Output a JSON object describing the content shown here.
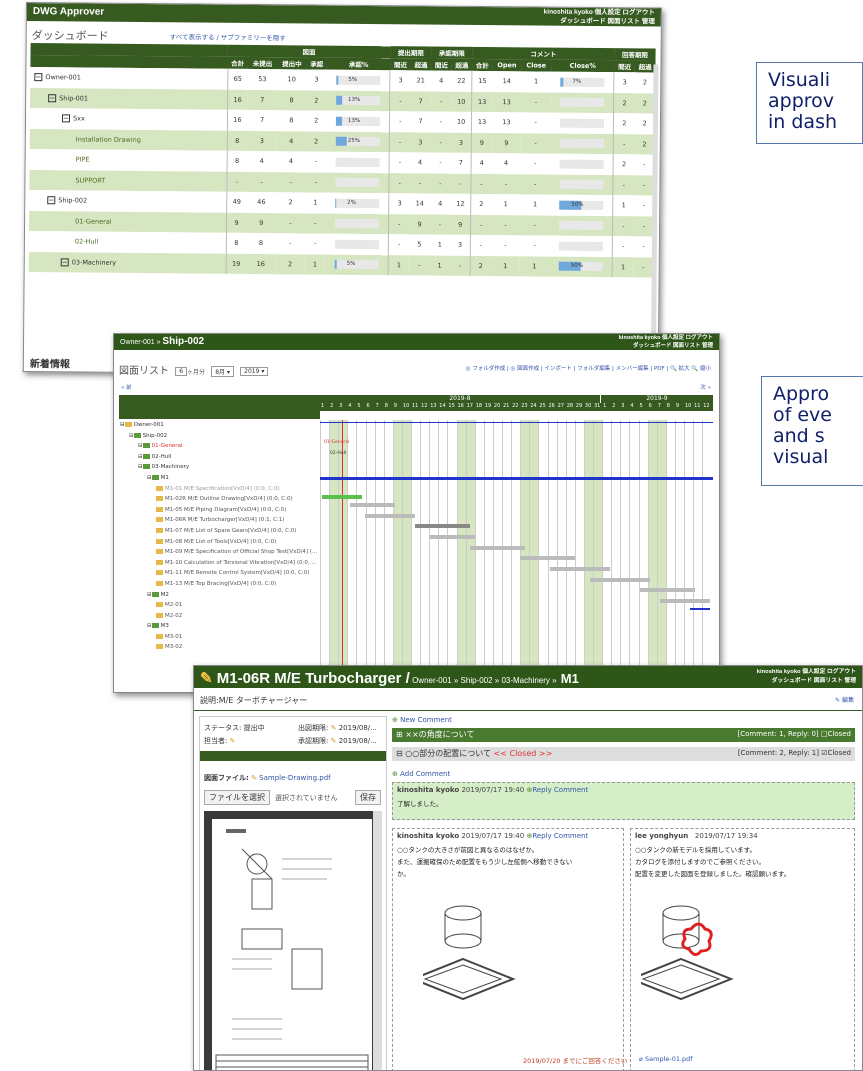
{
  "callouts": {
    "c1": [
      "Visuali",
      "approv",
      "in dash"
    ],
    "c2": [
      "Appro",
      "of eve",
      "and s",
      "visual"
    ]
  },
  "w1": {
    "app_title": "DWG Approver",
    "user_line1": "kinoshita kyoko 個人設定 ログアウト",
    "user_line2": "ダッシュボード 図面リスト 管理",
    "page_title": "ダッシュボード",
    "toggle_link": "すべて表示する / サブファミリーを隠す",
    "group_headers": [
      "図面",
      "提出期限",
      "承認期限",
      "コメント",
      "回答期限"
    ],
    "col_headers": [
      "合計",
      "未提出",
      "提出中",
      "承認",
      "承認%",
      "間近",
      "超過",
      "間近",
      "超過",
      "合計",
      "Open",
      "Close",
      "Close%",
      "間近",
      "超過"
    ],
    "rows": [
      {
        "name": "Owner-001",
        "exp": "−",
        "indent": 0,
        "bg": "w",
        "v": [
          "65",
          "53",
          "10",
          "3",
          "5%",
          "3",
          "21",
          "4",
          "22",
          "15",
          "14",
          "1",
          "7%",
          "3",
          "2"
        ],
        "p1": 5,
        "p2": 7
      },
      {
        "name": "Ship-001",
        "exp": "−",
        "indent": 1,
        "bg": "g",
        "v": [
          "16",
          "7",
          "8",
          "2",
          "13%",
          "-",
          "7",
          "-",
          "10",
          "13",
          "13",
          "-",
          "",
          "2",
          "2"
        ],
        "p1": 13,
        "p2": 0
      },
      {
        "name": "Sxx",
        "exp": "−",
        "indent": 2,
        "bg": "w",
        "v": [
          "16",
          "7",
          "8",
          "2",
          "13%",
          "-",
          "7",
          "-",
          "10",
          "13",
          "13",
          "-",
          "",
          "2",
          "2"
        ],
        "p1": 13,
        "p2": 0
      },
      {
        "name": "Installation Drawing",
        "exp": "",
        "indent": 3,
        "bg": "g",
        "v": [
          "8",
          "3",
          "4",
          "2",
          "25%",
          "-",
          "3",
          "-",
          "3",
          "9",
          "9",
          "-",
          "",
          "-",
          "2"
        ],
        "p1": 25,
        "p2": 0
      },
      {
        "name": "PIPE",
        "exp": "",
        "indent": 3,
        "bg": "w",
        "v": [
          "8",
          "4",
          "4",
          "-",
          "",
          "-",
          "4",
          "-",
          "7",
          "4",
          "4",
          "-",
          "",
          "2",
          "-"
        ],
        "p1": 0,
        "p2": 0
      },
      {
        "name": "SUPPORT",
        "exp": "",
        "indent": 3,
        "bg": "g",
        "v": [
          "-",
          "-",
          "-",
          "-",
          "",
          "-",
          "-",
          "-",
          "-",
          "-",
          "-",
          "-",
          "",
          "-",
          "-"
        ],
        "p1": 0,
        "p2": 0
      },
      {
        "name": "Ship-002",
        "exp": "−",
        "indent": 1,
        "bg": "w",
        "v": [
          "49",
          "46",
          "2",
          "1",
          "2%",
          "3",
          "14",
          "4",
          "12",
          "2",
          "1",
          "1",
          "50%",
          "1",
          "-"
        ],
        "p1": 2,
        "p2": 50
      },
      {
        "name": "01-General",
        "exp": "",
        "indent": 3,
        "bg": "g",
        "v": [
          "9",
          "9",
          "-",
          "-",
          "",
          "-",
          "9",
          "-",
          "9",
          "-",
          "-",
          "-",
          "",
          "-",
          "-"
        ],
        "p1": 0,
        "p2": 0
      },
      {
        "name": "02-Hull",
        "exp": "",
        "indent": 3,
        "bg": "w",
        "v": [
          "8",
          "8",
          "-",
          "-",
          "",
          "-",
          "5",
          "1",
          "3",
          "-",
          "-",
          "-",
          "",
          "-",
          "-"
        ],
        "p1": 0,
        "p2": 0
      },
      {
        "name": "03-Machinery",
        "exp": "−",
        "indent": 2,
        "bg": "g",
        "v": [
          "19",
          "16",
          "2",
          "1",
          "5%",
          "1",
          "-",
          "1",
          "-",
          "2",
          "1",
          "1",
          "50%",
          "1",
          "-"
        ],
        "p1": 5,
        "p2": 50
      }
    ],
    "news_title": "新着情報"
  },
  "w2": {
    "breadcrumb": "Owner-001 » ",
    "title": "Ship-002",
    "user_line1": "kinoshita kyoko 個人設定 ログアウト",
    "user_line2": "ダッシュボード 図面リスト 管理",
    "list_title": "図面リスト",
    "sel1": "6",
    "sel1_suffix": "ヶ月分",
    "sel2": "8月 ▾",
    "sel3": "2019 ▾",
    "toolbar": "◎ フォルダ作成 | ◎ 図面作成 | インポート | フォルダ編集 | メンバー編集 | PDF | 🔍 拡大 🔍 縮小",
    "prev": "« 前",
    "next": "次 »",
    "months": [
      "2019-8",
      "2019-9"
    ],
    "tree": [
      {
        "t": "Owner-001",
        "i": 0,
        "c": "#333",
        "exp": "⊟"
      },
      {
        "t": "Ship-002",
        "i": 1,
        "c": "#333",
        "exp": "⊟"
      },
      {
        "t": "01-General",
        "i": 2,
        "c": "#e03030",
        "exp": "⊟"
      },
      {
        "t": "02-Hull",
        "i": 2,
        "c": "#333",
        "exp": "⊟"
      },
      {
        "t": "03-Machinery",
        "i": 2,
        "c": "#333",
        "exp": "⊟"
      },
      {
        "t": "M1",
        "i": 3,
        "c": "#333",
        "exp": "⊟"
      },
      {
        "t": "M1-01 M/E Specification[VxD/4] (0:0, C:0)",
        "i": 4,
        "c": "#999",
        "exp": ""
      },
      {
        "t": "M1-02R M/E Outline Drawing[VxD/4] (0:0, C:0)",
        "i": 4,
        "c": "#555",
        "exp": ""
      },
      {
        "t": "M1-05 M/E Piping Diagram[VxD/4] (0:0, C:0)",
        "i": 4,
        "c": "#555",
        "exp": ""
      },
      {
        "t": "M1-06R M/E Turbocharger[VxD/4] (0:1, C:1)",
        "i": 4,
        "c": "#555",
        "exp": ""
      },
      {
        "t": "M1-07 M/E List of Spare Gears[VxD/4] (0:0, C:0)",
        "i": 4,
        "c": "#555",
        "exp": ""
      },
      {
        "t": "M1-08 M/E List of Tools[VxD/4] (0:0, C:0)",
        "i": 4,
        "c": "#555",
        "exp": ""
      },
      {
        "t": "M1-09 M/E Specification of Official Shop Test[VxD/4] (...",
        "i": 4,
        "c": "#555",
        "exp": ""
      },
      {
        "t": "M1-10 Calculation of Torsional Vibration[VxD/4] (0:0, ...",
        "i": 4,
        "c": "#555",
        "exp": ""
      },
      {
        "t": "M1-11 M/E Remote Control System[VxD/4] (0:0, C:0)",
        "i": 4,
        "c": "#555",
        "exp": ""
      },
      {
        "t": "M1-13 M/E Top Bracing[VxD/4] (0:0, C:0)",
        "i": 4,
        "c": "#555",
        "exp": ""
      },
      {
        "t": "M2",
        "i": 3,
        "c": "#333",
        "exp": "⊟"
      },
      {
        "t": "M2-01",
        "i": 4,
        "c": "#555",
        "exp": ""
      },
      {
        "t": "M2-02",
        "i": 4,
        "c": "#555",
        "exp": ""
      },
      {
        "t": "M3",
        "i": 3,
        "c": "#333",
        "exp": "⊟"
      },
      {
        "t": "M3-01",
        "i": 4,
        "c": "#555",
        "exp": ""
      },
      {
        "t": "M3-02",
        "i": 4,
        "c": "#555",
        "exp": ""
      }
    ],
    "gantt_labels": [
      "01-General",
      "02-Hull"
    ]
  },
  "w3": {
    "title": "M1-06R M/E Turbocharger /",
    "breadcrumb": " Owner-001 » Ship-002 » 03-Machinery »",
    "title_end": "M1",
    "user_line1": "kinoshita kyoko 個人設定 ログアウト",
    "user_line2": "ダッシュボード 図面リスト 管理",
    "description": "説明:M/E ターボチャージャー",
    "edit": "✎ 編集",
    "status": "ステータス: 提出中",
    "assignee": "担当者:",
    "submit_due": "出図期限:",
    "submit_date": "2019/08/...",
    "approve_due": "承認期限:",
    "approve_date": "2019/08/...",
    "drawing_file": "図面ファイル:",
    "file_name": "Sample-Drawing.pdf",
    "choose_file": "ファイルを選択",
    "no_file": "選択されていません",
    "save": "保存",
    "new_comment": "New Comment",
    "thread1_title": "××の角度について",
    "thread1_meta": "[Comment: 1, Reply: 0] □Closed",
    "thread2_title": "○○部分の配置について",
    "thread2_closed": "<< Closed >>",
    "thread2_meta": "[Comment: 2, Reply: 1] ☑Closed",
    "add_comment": "Add Comment",
    "c1_author": "kinoshita kyoko",
    "c1_time": "2019/07/17 19:40",
    "c1_reply": "Reply Comment",
    "c1_text": "了解しました。",
    "c2_author": "kinoshita kyoko",
    "c2_time": "2019/07/17 19:40",
    "c2_reply": "Reply Comment",
    "c2_text": [
      "○○タンクの大きさが前図と異なるのはなぜか。",
      "また、運搬確保のため配置をもう少し左舷側へ移動できない",
      "か。"
    ],
    "c2_due": "2019/07/20 までにご回答ください",
    "c3_author": "lee yonghyun",
    "c3_time": "2019/07/17 19:34",
    "c3_text": [
      "○○タンクの新モデルを採用しています。",
      "カタログを添付しますのでご参照ください。",
      "配置を変更した図面を登録しました。確認願います。"
    ],
    "c3_file": "Sample-01.pdf"
  }
}
